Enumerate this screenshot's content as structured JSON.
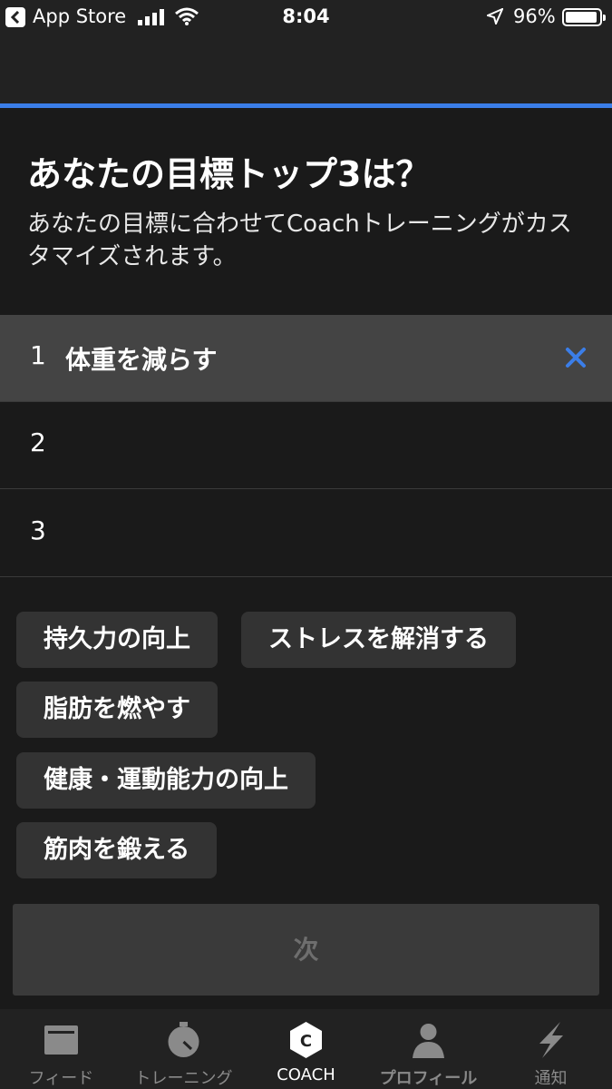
{
  "status_bar": {
    "back_app": "App Store",
    "time": "8:04",
    "battery": "96%"
  },
  "header": {
    "title": "あなたの目標トップ3は？",
    "subtitle": "あなたの目標に合わせてCoachトレーニングがカスタマイズされます。"
  },
  "goals": [
    {
      "number": "1",
      "label": "体重を減らす"
    },
    {
      "number": "2",
      "label": ""
    },
    {
      "number": "3",
      "label": ""
    }
  ],
  "options": [
    "持久力の向上",
    "ストレスを解消する",
    "脂肪を燃やす",
    "健康・運動能力の向上",
    "筋肉を鍛える"
  ],
  "next_label": "次",
  "tabs": [
    {
      "label": "フィード",
      "icon": "feed-icon"
    },
    {
      "label": "トレーニング",
      "icon": "stopwatch-icon"
    },
    {
      "label": "COACH",
      "icon": "coach-icon"
    },
    {
      "label": "プロフィール",
      "icon": "profile-icon"
    },
    {
      "label": "通知",
      "icon": "lightning-icon"
    }
  ],
  "colors": {
    "accent": "#3b7ee8",
    "background": "#1a1a1a",
    "selected_row": "#444444",
    "chip": "#333333"
  }
}
